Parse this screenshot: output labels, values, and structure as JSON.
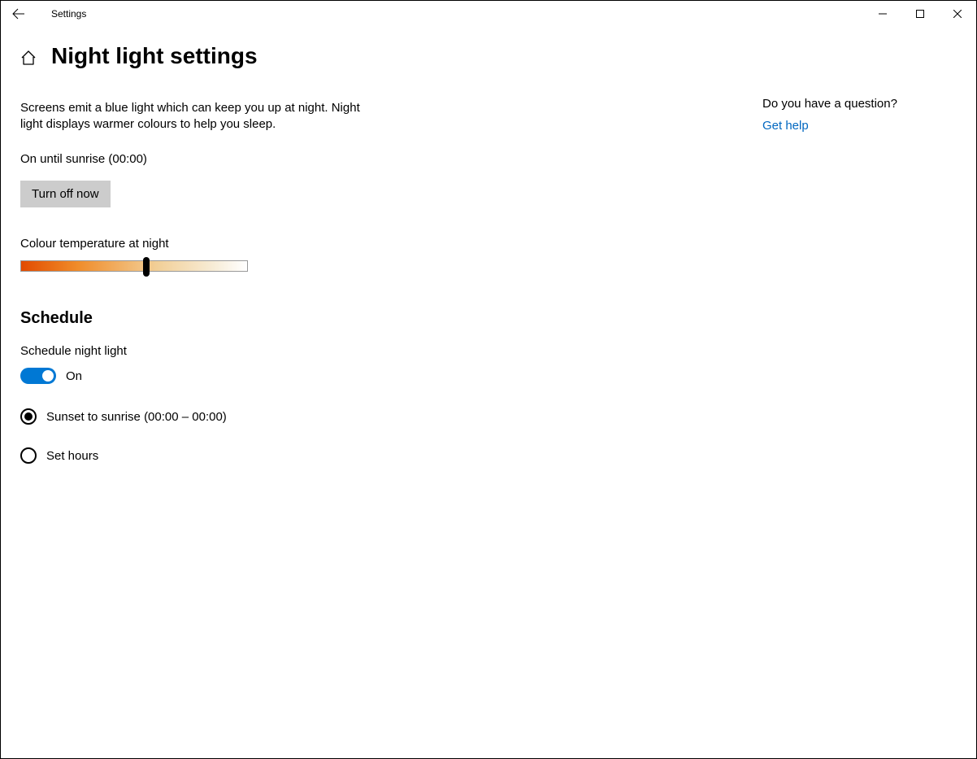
{
  "window": {
    "app_title": "Settings"
  },
  "page": {
    "title": "Night light settings",
    "description": "Screens emit a blue light which can keep you up at night. Night light displays warmer colours to help you sleep.",
    "status": "On until sunrise (00:00)",
    "turn_off_label": "Turn off now",
    "slider_label": "Colour temperature at night"
  },
  "schedule": {
    "heading": "Schedule",
    "toggle_label": "Schedule night light",
    "toggle_state": "On",
    "option_sunset": "Sunset to sunrise (00:00 – 00:00)",
    "option_hours": "Set hours"
  },
  "help": {
    "question": "Do you have a question?",
    "link": "Get help"
  }
}
